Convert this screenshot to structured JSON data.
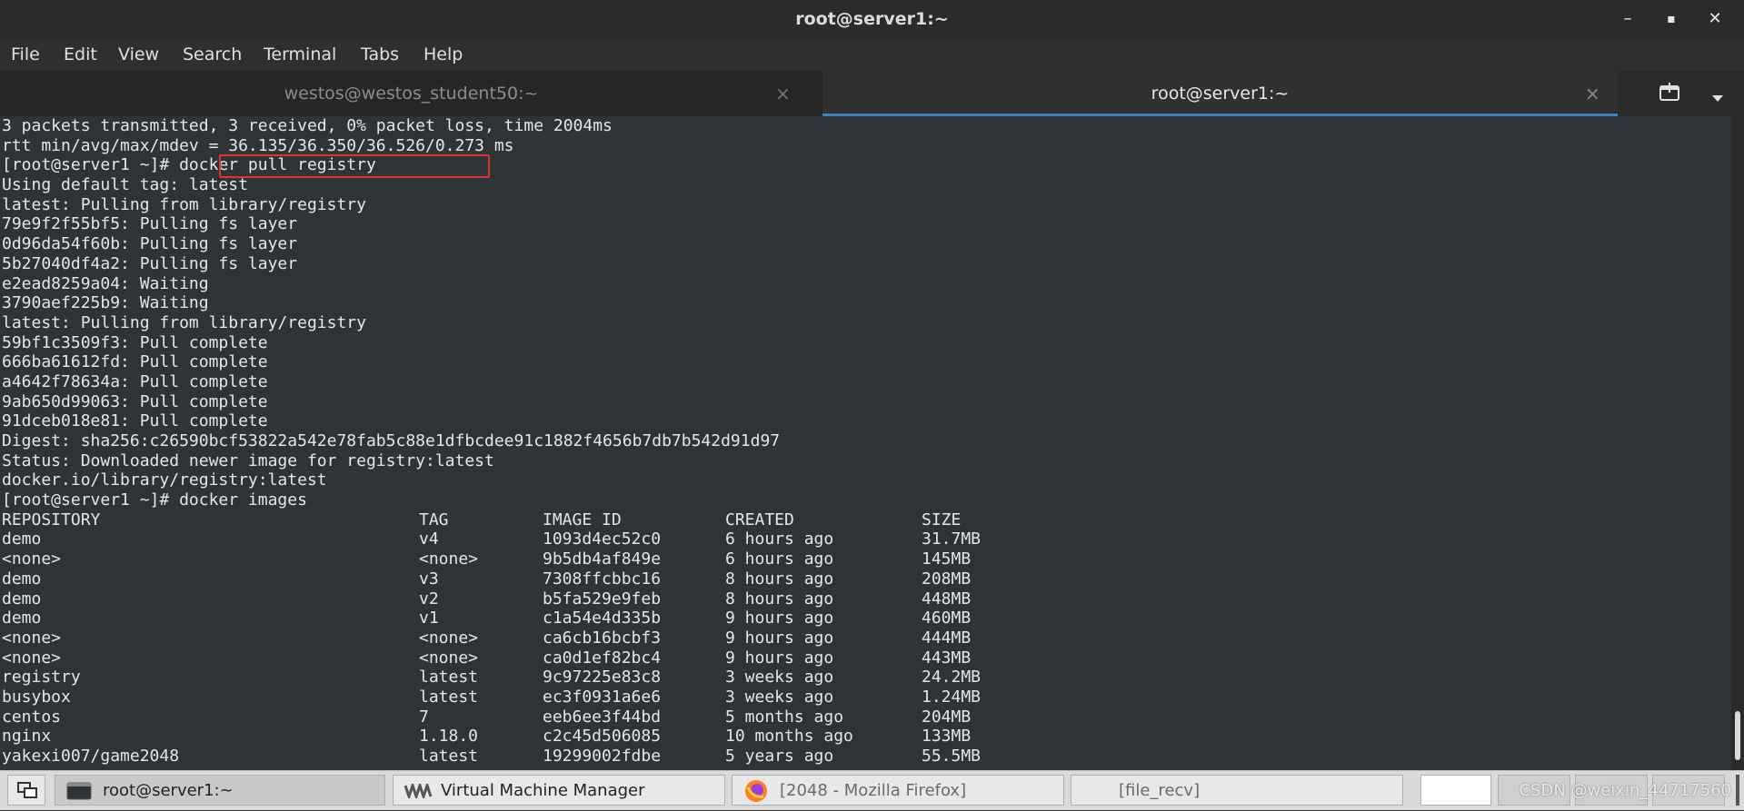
{
  "window": {
    "title": "root@server1:~",
    "minimize": "–",
    "maximize": "▪",
    "close": "✕"
  },
  "menu": [
    "File",
    "Edit",
    "View",
    "Search",
    "Terminal",
    "Tabs",
    "Help"
  ],
  "tabs": [
    {
      "label": "westos@westos_student50:~",
      "active": false
    },
    {
      "label": "root@server1:~",
      "active": true
    }
  ],
  "tab_close": "×",
  "icons": {
    "new_tab": "new-tab-icon",
    "tab_menu": "chevron-down-icon",
    "show_desktop": "show-desktop-icon",
    "terminal": "terminal-icon",
    "vmm": "virtual-machine-manager-icon",
    "firefox": "firefox-icon"
  },
  "terminal": {
    "lines": [
      "3 packets transmitted, 3 received, 0% packet loss, time 2004ms",
      "rtt min/avg/max/mdev = 36.135/36.350/36.526/0.273 ms",
      "[root@server1 ~]# docker pull registry",
      "Using default tag: latest",
      "latest: Pulling from library/registry",
      "79e9f2f55bf5: Pulling fs layer",
      "0d96da54f60b: Pulling fs layer",
      "5b27040df4a2: Pulling fs layer",
      "e2ead8259a04: Waiting",
      "3790aef225b9: Waiting",
      "latest: Pulling from library/registry",
      "59bf1c3509f3: Pull complete",
      "666ba61612fd: Pull complete",
      "a4642f78634a: Pull complete",
      "9ab650d99063: Pull complete",
      "91dceb018e81: Pull complete",
      "Digest: sha256:c26590bcf53822a542e78fab5c88e1dfbcdee91c1882f4656b7db7b542d91d97",
      "Status: Downloaded newer image for registry:latest",
      "docker.io/library/registry:latest",
      "[root@server1 ~]# docker images"
    ],
    "images_table": {
      "headers": [
        "REPOSITORY",
        "TAG",
        "IMAGE ID",
        "CREATED",
        "SIZE"
      ],
      "rows": [
        [
          "demo",
          "v4",
          "1093d4ec52c0",
          "6 hours ago",
          "31.7MB"
        ],
        [
          "<none>",
          "<none>",
          "9b5db4af849e",
          "6 hours ago",
          "145MB"
        ],
        [
          "demo",
          "v3",
          "7308ffcbbc16",
          "8 hours ago",
          "208MB"
        ],
        [
          "demo",
          "v2",
          "b5fa529e9feb",
          "8 hours ago",
          "448MB"
        ],
        [
          "demo",
          "v1",
          "c1a54e4d335b",
          "9 hours ago",
          "460MB"
        ],
        [
          "<none>",
          "<none>",
          "ca6cb16bcbf3",
          "9 hours ago",
          "444MB"
        ],
        [
          "<none>",
          "<none>",
          "ca0d1ef82bc4",
          "9 hours ago",
          "443MB"
        ],
        [
          "registry",
          "latest",
          "9c97225e83c8",
          "3 weeks ago",
          "24.2MB"
        ],
        [
          "busybox",
          "latest",
          "ec3f0931a6e6",
          "3 weeks ago",
          "1.24MB"
        ],
        [
          "centos",
          "7",
          "eeb6ee3f44bd",
          "5 months ago",
          "204MB"
        ],
        [
          "nginx",
          "1.18.0",
          "c2c45d506085",
          "10 months ago",
          "133MB"
        ],
        [
          "yakexi007/game2048",
          "latest",
          "19299002fdbe",
          "5 years ago",
          "55.5MB"
        ]
      ]
    }
  },
  "taskbar": {
    "items": [
      "root@server1:~",
      "Virtual Machine Manager",
      "[2048 - Mozilla Firefox]",
      "[file_recv]"
    ]
  },
  "watermark": "CSDN @weixin_44717560",
  "colors": {
    "highlight_box": "#e53030",
    "active_tab_underline": "#3d82c4",
    "terminal_bg": "#2e3436"
  }
}
